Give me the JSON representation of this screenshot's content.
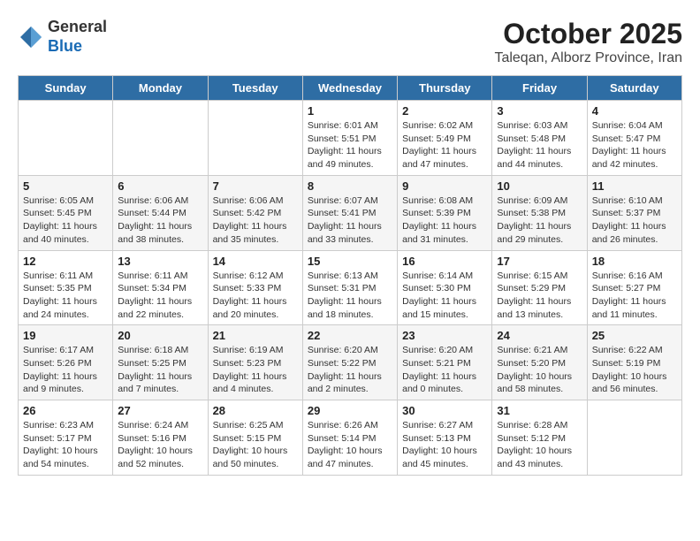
{
  "header": {
    "logo_line1": "General",
    "logo_line2": "Blue",
    "month": "October 2025",
    "location": "Taleqan, Alborz Province, Iran"
  },
  "weekdays": [
    "Sunday",
    "Monday",
    "Tuesday",
    "Wednesday",
    "Thursday",
    "Friday",
    "Saturday"
  ],
  "weeks": [
    [
      {
        "day": "",
        "info": ""
      },
      {
        "day": "",
        "info": ""
      },
      {
        "day": "",
        "info": ""
      },
      {
        "day": "1",
        "info": "Sunrise: 6:01 AM\nSunset: 5:51 PM\nDaylight: 11 hours\nand 49 minutes."
      },
      {
        "day": "2",
        "info": "Sunrise: 6:02 AM\nSunset: 5:49 PM\nDaylight: 11 hours\nand 47 minutes."
      },
      {
        "day": "3",
        "info": "Sunrise: 6:03 AM\nSunset: 5:48 PM\nDaylight: 11 hours\nand 44 minutes."
      },
      {
        "day": "4",
        "info": "Sunrise: 6:04 AM\nSunset: 5:47 PM\nDaylight: 11 hours\nand 42 minutes."
      }
    ],
    [
      {
        "day": "5",
        "info": "Sunrise: 6:05 AM\nSunset: 5:45 PM\nDaylight: 11 hours\nand 40 minutes."
      },
      {
        "day": "6",
        "info": "Sunrise: 6:06 AM\nSunset: 5:44 PM\nDaylight: 11 hours\nand 38 minutes."
      },
      {
        "day": "7",
        "info": "Sunrise: 6:06 AM\nSunset: 5:42 PM\nDaylight: 11 hours\nand 35 minutes."
      },
      {
        "day": "8",
        "info": "Sunrise: 6:07 AM\nSunset: 5:41 PM\nDaylight: 11 hours\nand 33 minutes."
      },
      {
        "day": "9",
        "info": "Sunrise: 6:08 AM\nSunset: 5:39 PM\nDaylight: 11 hours\nand 31 minutes."
      },
      {
        "day": "10",
        "info": "Sunrise: 6:09 AM\nSunset: 5:38 PM\nDaylight: 11 hours\nand 29 minutes."
      },
      {
        "day": "11",
        "info": "Sunrise: 6:10 AM\nSunset: 5:37 PM\nDaylight: 11 hours\nand 26 minutes."
      }
    ],
    [
      {
        "day": "12",
        "info": "Sunrise: 6:11 AM\nSunset: 5:35 PM\nDaylight: 11 hours\nand 24 minutes."
      },
      {
        "day": "13",
        "info": "Sunrise: 6:11 AM\nSunset: 5:34 PM\nDaylight: 11 hours\nand 22 minutes."
      },
      {
        "day": "14",
        "info": "Sunrise: 6:12 AM\nSunset: 5:33 PM\nDaylight: 11 hours\nand 20 minutes."
      },
      {
        "day": "15",
        "info": "Sunrise: 6:13 AM\nSunset: 5:31 PM\nDaylight: 11 hours\nand 18 minutes."
      },
      {
        "day": "16",
        "info": "Sunrise: 6:14 AM\nSunset: 5:30 PM\nDaylight: 11 hours\nand 15 minutes."
      },
      {
        "day": "17",
        "info": "Sunrise: 6:15 AM\nSunset: 5:29 PM\nDaylight: 11 hours\nand 13 minutes."
      },
      {
        "day": "18",
        "info": "Sunrise: 6:16 AM\nSunset: 5:27 PM\nDaylight: 11 hours\nand 11 minutes."
      }
    ],
    [
      {
        "day": "19",
        "info": "Sunrise: 6:17 AM\nSunset: 5:26 PM\nDaylight: 11 hours\nand 9 minutes."
      },
      {
        "day": "20",
        "info": "Sunrise: 6:18 AM\nSunset: 5:25 PM\nDaylight: 11 hours\nand 7 minutes."
      },
      {
        "day": "21",
        "info": "Sunrise: 6:19 AM\nSunset: 5:23 PM\nDaylight: 11 hours\nand 4 minutes."
      },
      {
        "day": "22",
        "info": "Sunrise: 6:20 AM\nSunset: 5:22 PM\nDaylight: 11 hours\nand 2 minutes."
      },
      {
        "day": "23",
        "info": "Sunrise: 6:20 AM\nSunset: 5:21 PM\nDaylight: 11 hours\nand 0 minutes."
      },
      {
        "day": "24",
        "info": "Sunrise: 6:21 AM\nSunset: 5:20 PM\nDaylight: 10 hours\nand 58 minutes."
      },
      {
        "day": "25",
        "info": "Sunrise: 6:22 AM\nSunset: 5:19 PM\nDaylight: 10 hours\nand 56 minutes."
      }
    ],
    [
      {
        "day": "26",
        "info": "Sunrise: 6:23 AM\nSunset: 5:17 PM\nDaylight: 10 hours\nand 54 minutes."
      },
      {
        "day": "27",
        "info": "Sunrise: 6:24 AM\nSunset: 5:16 PM\nDaylight: 10 hours\nand 52 minutes."
      },
      {
        "day": "28",
        "info": "Sunrise: 6:25 AM\nSunset: 5:15 PM\nDaylight: 10 hours\nand 50 minutes."
      },
      {
        "day": "29",
        "info": "Sunrise: 6:26 AM\nSunset: 5:14 PM\nDaylight: 10 hours\nand 47 minutes."
      },
      {
        "day": "30",
        "info": "Sunrise: 6:27 AM\nSunset: 5:13 PM\nDaylight: 10 hours\nand 45 minutes."
      },
      {
        "day": "31",
        "info": "Sunrise: 6:28 AM\nSunset: 5:12 PM\nDaylight: 10 hours\nand 43 minutes."
      },
      {
        "day": "",
        "info": ""
      }
    ]
  ]
}
